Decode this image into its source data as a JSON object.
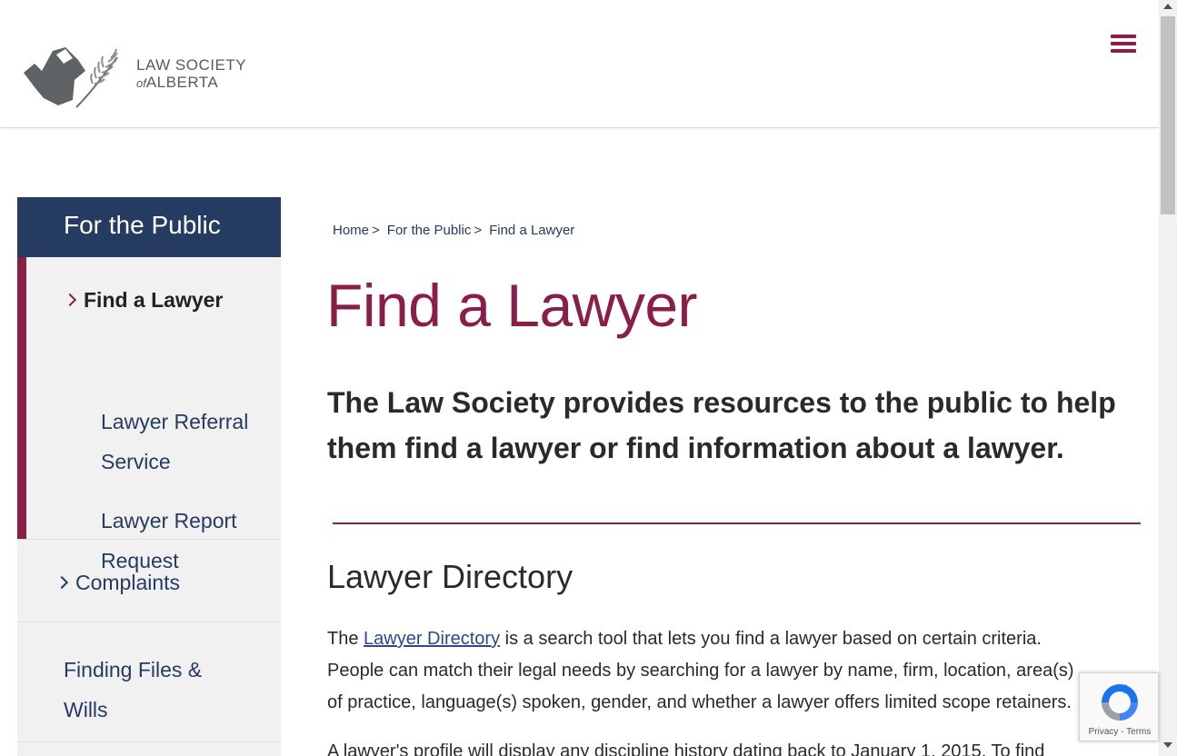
{
  "header": {
    "logo_line1": "LAW SOCIETY",
    "logo_of": "of",
    "logo_line2": "ALBERTA",
    "menu_icon": "hamburger-menu-icon"
  },
  "sidebar": {
    "heading": "For the Public",
    "active_item": "Find a Lawyer",
    "sub_items": [
      "Lawyer Referral Service",
      "Lawyer Report Request"
    ],
    "items": [
      "Complaints",
      "Finding Files & Wills"
    ]
  },
  "breadcrumb": {
    "items": [
      "Home",
      "For the Public",
      "Find a Lawyer"
    ],
    "separator": ">"
  },
  "main": {
    "title": "Find a Lawyer",
    "lead": "The Law Society provides resources to the public to help them find a lawyer or find information about a lawyer.",
    "section_title": "Lawyer Directory",
    "para1_before": "The ",
    "para1_link": "Lawyer Directory",
    "para1_after": " is a search tool that lets you find a lawyer based on certain criteria. People can match their legal needs by searching for a lawyer by name, firm, location, area(s) of practice, language(s) spoken, gender, and whether a lawyer offers limited scope retainers.",
    "para2": "A lawyer's profile will display any discipline history dating back to January 1, 2015. To find"
  },
  "recaptcha": {
    "links": "Privacy - Terms"
  },
  "colors": {
    "brand_maroon": "#8b1e48",
    "navy": "#253b61",
    "sidebar_bg": "#f1f1f1"
  }
}
